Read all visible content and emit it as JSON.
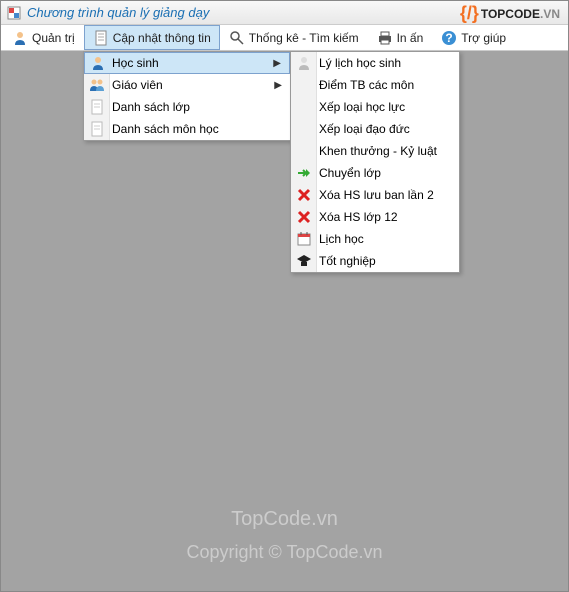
{
  "title": "Chương trình quản lý giảng dạy",
  "logo": {
    "text1": "TOPCODE",
    "text2": ".VN"
  },
  "menubar": [
    {
      "label": "Quản trị",
      "icon": "user"
    },
    {
      "label": "Cập nhật thông tin",
      "icon": "doc",
      "open": true
    },
    {
      "label": "Thống kê - Tìm kiếm",
      "icon": "search"
    },
    {
      "label": "In ấn",
      "icon": "printer"
    },
    {
      "label": "Trợ giúp",
      "icon": "help"
    }
  ],
  "dropdown1": [
    {
      "label": "Học sinh",
      "icon": "user-blue",
      "submenu": true,
      "highlight": true
    },
    {
      "label": "Giáo viên",
      "icon": "users",
      "submenu": true
    },
    {
      "label": "Danh sách lớp",
      "icon": "page"
    },
    {
      "label": "Danh sách môn học",
      "icon": "page"
    }
  ],
  "dropdown2": [
    {
      "label": "Lý lịch học sinh",
      "icon": "user-gray"
    },
    {
      "label": "Điểm TB các môn"
    },
    {
      "label": "Xếp loại học lực"
    },
    {
      "label": "Xếp loại đạo đức"
    },
    {
      "label": "Khen thưởng - Kỷ luật"
    },
    {
      "label": "Chuyển lớp",
      "icon": "arrow-green"
    },
    {
      "label": "Xóa HS lưu ban lần 2",
      "icon": "x-red"
    },
    {
      "label": "Xóa HS lớp 12",
      "icon": "x-red"
    },
    {
      "label": "Lịch học",
      "icon": "calendar"
    },
    {
      "label": "Tốt nghiệp",
      "icon": "grad"
    }
  ],
  "watermark1": "TopCode.vn",
  "watermark2": "Copyright © TopCode.vn"
}
